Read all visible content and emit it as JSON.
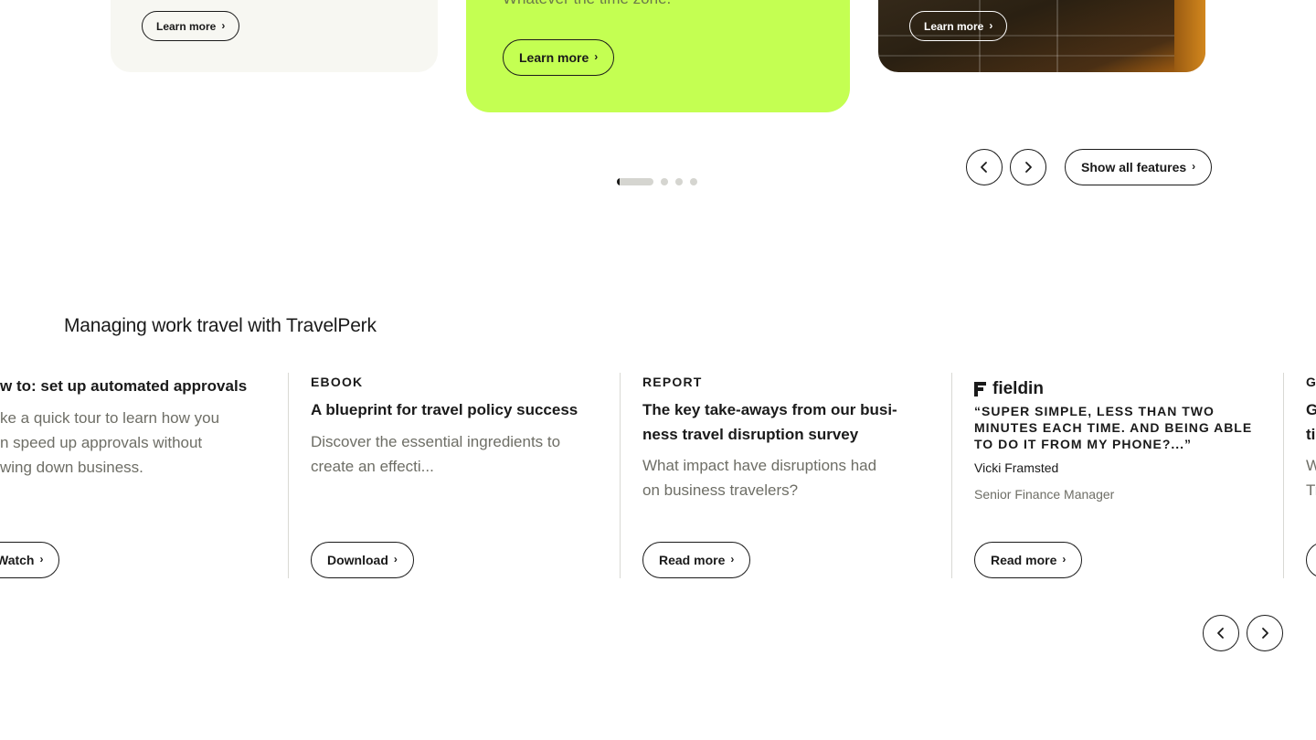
{
  "feature_cards": {
    "left_button": "Learn more",
    "mid_text": "Whatever the time zone.",
    "mid_button": "Learn more",
    "right_button": "Learn more"
  },
  "carousel": {
    "show_all_label": "Show all features",
    "slide_count": 4,
    "active_slide": 1
  },
  "resources": {
    "title": "Managing work travel with TravelPerk",
    "items": [
      {
        "title": "w to: set up automated approvals",
        "description_lines": [
          "ke a quick tour to learn how you",
          "n speed up approvals without",
          "wing down business."
        ],
        "button": "Watch"
      },
      {
        "kicker": "EBOOK",
        "title": "A blueprint for travel policy success",
        "description_lines": [
          "Discover the essential ingredients to",
          "create an effecti..."
        ],
        "button": "Download"
      },
      {
        "kicker": "REPORT",
        "title_lines": [
          "The key take-aways from our busi-",
          "ness travel disruption survey"
        ],
        "description_lines": [
          "What impact have disruptions had",
          "on business travelers?"
        ],
        "button": "Read more"
      },
      {
        "logo": "fieldin",
        "quote_lines": [
          "“SUPER SIMPLE, LESS THAN TWO",
          "MINUTES EACH TIME. AND BEING ABLE",
          "TO DO IT FROM MY PHONE?...”"
        ],
        "person": "Vicki Framsted",
        "role": "Senior Finance Manager",
        "button": "Read more"
      },
      {
        "kicker": "G",
        "title_lines": [
          "G",
          "ti"
        ],
        "description_lines": [
          "W",
          "Tr"
        ]
      }
    ]
  },
  "icons": {
    "prev": "chevron-left-icon",
    "next": "chevron-right-icon",
    "arrow": "chevron-right-icon",
    "logo": "fieldin-logo-icon"
  }
}
